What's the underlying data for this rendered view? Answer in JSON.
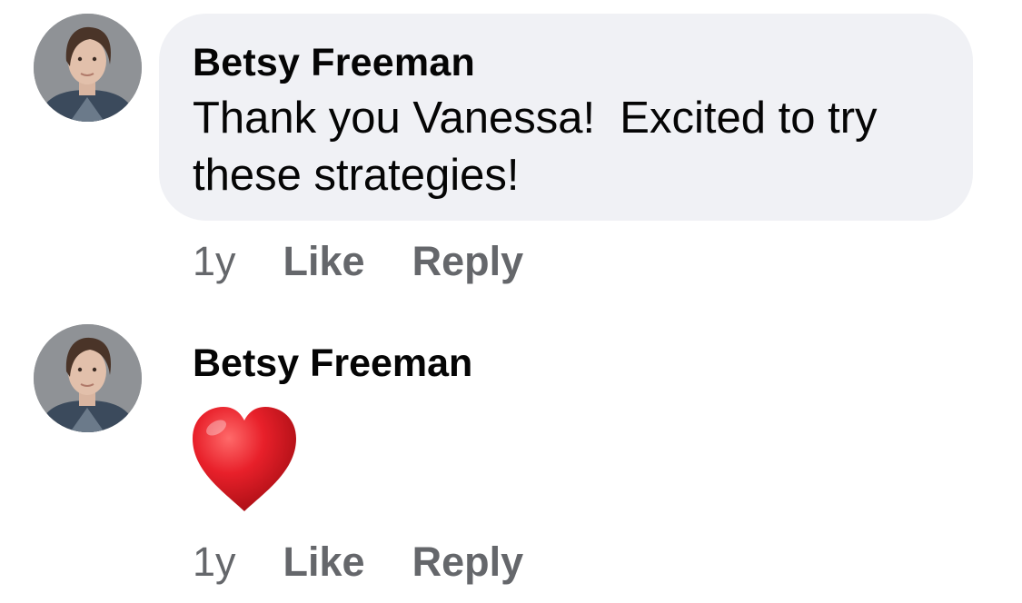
{
  "comments": [
    {
      "author": "Betsy Freeman",
      "text": "Thank you Vanessa!  Excited to try these strategies!",
      "time": "1y",
      "like_label": "Like",
      "reply_label": "Reply"
    },
    {
      "author": "Betsy Freeman",
      "reaction": "red-heart-emoji",
      "time": "1y",
      "like_label": "Like",
      "reply_label": "Reply"
    }
  ],
  "colors": {
    "bubble": "#f0f1f5",
    "text": "#050505",
    "secondary": "#65676b",
    "heart": "#e0191f"
  }
}
